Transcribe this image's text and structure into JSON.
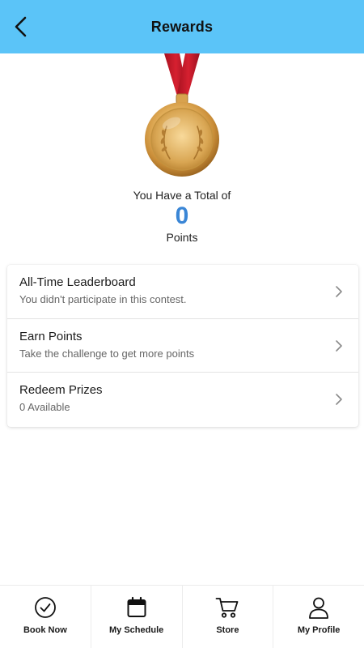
{
  "header": {
    "title": "Rewards",
    "back_icon": "back-arrow-icon",
    "background": "#5bc4f8"
  },
  "summary": {
    "caption": "You Have a Total of",
    "points": "0",
    "unit": "Points",
    "points_color": "#3a86d6",
    "medal_icon": "gold-medal-icon"
  },
  "menu": {
    "items": [
      {
        "title": "All-Time Leaderboard",
        "subtitle": "You didn't participate in this contest."
      },
      {
        "title": "Earn Points",
        "subtitle": "Take the challenge to get more points"
      },
      {
        "title": "Redeem Prizes",
        "subtitle": "0 Available"
      }
    ]
  },
  "nav": {
    "items": [
      {
        "label": "Book Now",
        "icon": "check-circle-icon"
      },
      {
        "label": "My Schedule",
        "icon": "calendar-icon"
      },
      {
        "label": "Store",
        "icon": "cart-icon"
      },
      {
        "label": "My Profile",
        "icon": "person-icon"
      }
    ]
  }
}
